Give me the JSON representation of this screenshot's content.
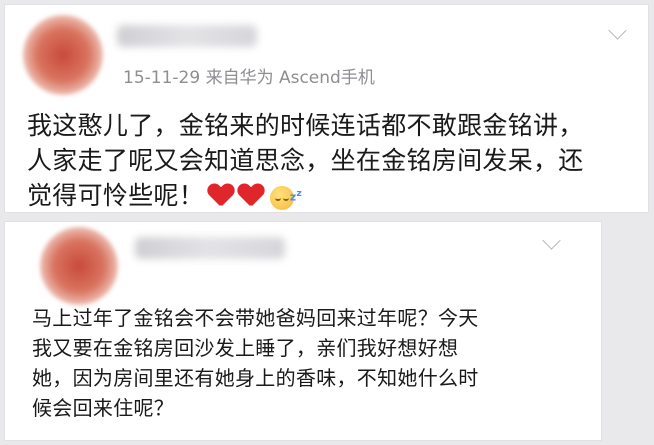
{
  "posts": [
    {
      "meta": "15-11-29  来自华为 Ascend手机",
      "lines": [
        "我这憨儿了，金铭来的时候连话都不敢跟金铭讲，",
        "人家走了呢又会知道思念，坐在金铭房间发呆，还",
        "觉得可怜些呢！"
      ],
      "emojis": [
        "red-heart",
        "red-heart",
        "sleeping-face"
      ]
    },
    {
      "lines": [
        "马上过年了金铭会不会带她爸妈回来过年呢？今天",
        "我又要在金铭房回沙发上睡了，亲们我好想好想",
        "她，因为房间里还有她身上的香味，不知她什么时",
        "候会回来住呢？"
      ]
    }
  ],
  "colors": {
    "background": "#e9e9ec",
    "card": "#ffffff",
    "meta_text": "#8e8e93",
    "heart": "#e0262a"
  },
  "icons": [
    "chevron-down-icon",
    "red-heart-icon",
    "sleeping-face-icon"
  ]
}
